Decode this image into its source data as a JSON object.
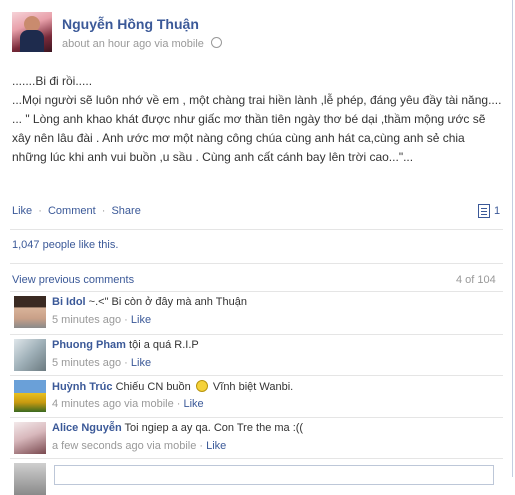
{
  "post": {
    "author": "Nguyễn Hồng Thuận",
    "time": "about an hour ago",
    "via": "via mobile",
    "message": [
      ".......Bi đi rồi.....",
      "...Mọi người sẽ luôn nhớ về em , một chàng trai hiền lành ,lễ phép, đáng yêu đầy tài năng....",
      "... \" Lòng anh khao khát được như giấc mơ thần tiên ngày thơ bé dại ,thầm mộng ước sẽ xây nên lâu đài . Anh ước mơ một nàng công chúa cùng anh hát ca,cùng anh sẻ chia những lúc khi anh vui buồn ,u sầu . Cùng anh cất cánh bay lên trời cao...\"..."
    ]
  },
  "actions": {
    "like": "Like",
    "comment": "Comment",
    "share": "Share",
    "share_count": "1"
  },
  "likes_text": "1,047 people like this.",
  "comments_header": {
    "view_previous": "View previous comments",
    "count": "4 of 104"
  },
  "comments": [
    {
      "name": "Bi Idol",
      "text": "~.<\" Bi còn ở đây mà anh Thuận",
      "time": "5 minutes ago",
      "via": "",
      "like": "Like"
    },
    {
      "name": "Phuong Pham",
      "text": "tội a quá R.I.P",
      "time": "5 minutes ago",
      "via": "",
      "like": "Like"
    },
    {
      "name": "Huỳnh Trúc",
      "text_before": "Chiếu CN buồn",
      "text_after": "Vĩnh biệt Wanbi.",
      "time": "4 minutes ago",
      "via": "via mobile",
      "like": "Like"
    },
    {
      "name": "Alice Nguyễn",
      "text": "Toi ngiep a ay qa. Con Tre the ma :((",
      "time": "a few seconds ago",
      "via": "via mobile",
      "like": "Like"
    }
  ]
}
